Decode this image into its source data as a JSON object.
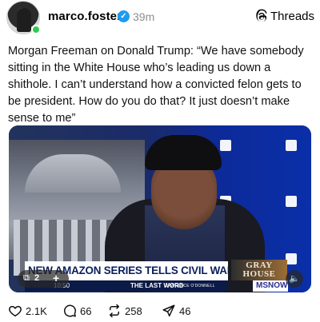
{
  "post": {
    "username": "marco.foster",
    "verified_icon": "verified-badge-icon",
    "time": "39m",
    "app_label": "Threads",
    "text": "Morgan Freeman on Donald Trump: “We have somebody sitting in the White House who’s leading us down a shithole. I can’t understand how a convicted felon gets to be president. How do you do that? It just doesn’t make sense to me”"
  },
  "media": {
    "headline": "NEW AMAZON SERIES TELLS CIVIL WAR RESISTANCE STORY",
    "promo_logo": "GRAY HOUSE",
    "time_code": "10:50",
    "show_name": "THE LAST WORD",
    "host": "LAWRENCE O'DONNELL",
    "network": "MSNOW",
    "carousel_count": "2",
    "carousel_icon": "carousel-icon",
    "audio_icon": "speaker-icon"
  },
  "actions": {
    "likes": "2.1K",
    "comments": "66",
    "reposts": "258",
    "shares": "46"
  },
  "colors": {
    "verified": "#1d9bf0",
    "online": "#2fcb4f",
    "meta_text": "#8e8e8e"
  }
}
